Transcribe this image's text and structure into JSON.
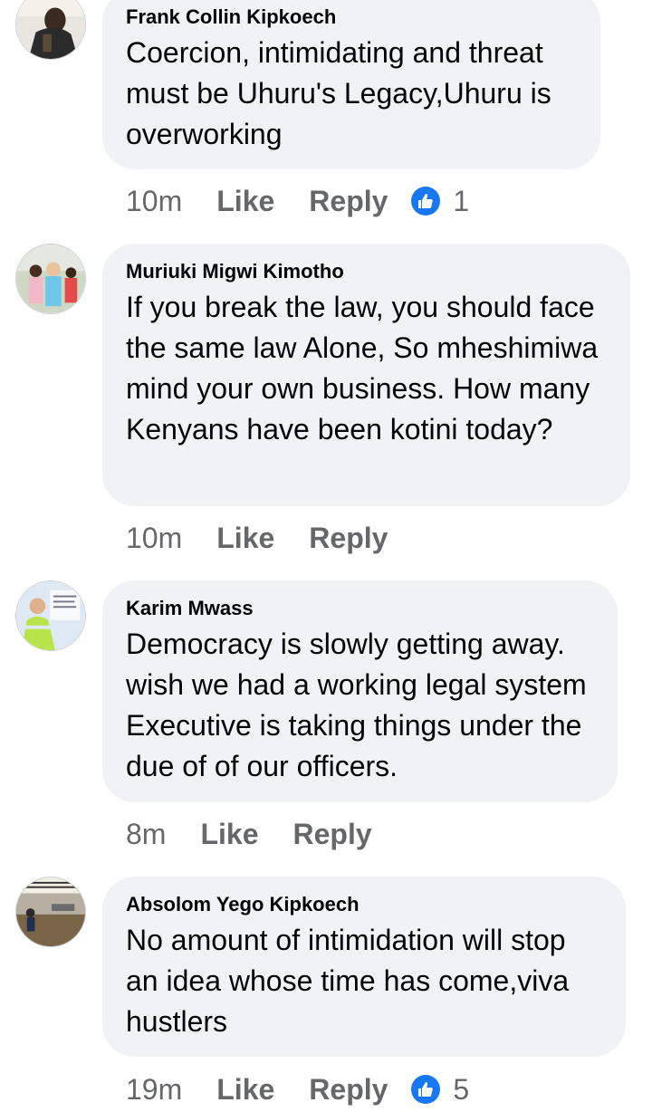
{
  "colors": {
    "bubble": "#f0f2f5",
    "meta": "#65676b",
    "like_blue": "#1877f2"
  },
  "comments": [
    {
      "author": "Frank Collin Kipkoech",
      "text": "Coercion, intimidating and threat must be Uhuru's Legacy,Uhuru is overworking",
      "time": "10m",
      "like": "Like",
      "reply": "Reply",
      "reactions": "1",
      "avatar_icon": "profile-photo"
    },
    {
      "author": "Muriuki Migwi Kimotho",
      "text": "If you break the law, you should face the same law Alone, So mheshimiwa mind your own business. How many Kenyans have been kotini today?",
      "time": "10m",
      "like": "Like",
      "reply": "Reply",
      "avatar_icon": "profile-photo"
    },
    {
      "author": "Karim Mwass",
      "text": "Democracy is slowly getting away. wish we had a working legal system Executive is taking things under the due of of our officers.",
      "time": "8m",
      "like": "Like",
      "reply": "Reply",
      "avatar_icon": "profile-photo"
    },
    {
      "author": "Absolom Yego Kipkoech",
      "text": "No amount of intimidation will stop an idea whose time has come,viva hustlers",
      "time": "19m",
      "like": "Like",
      "reply": "Reply",
      "reactions": "5",
      "avatar_icon": "profile-photo"
    }
  ]
}
